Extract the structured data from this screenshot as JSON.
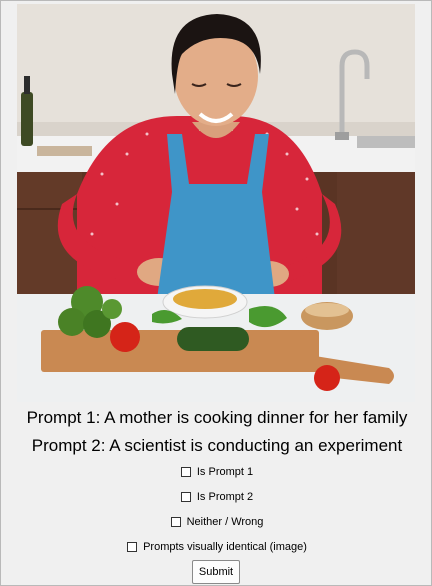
{
  "image": {
    "alt": "",
    "subject_icon": "cooking-scene-image"
  },
  "prompts": {
    "prompt1": "Prompt 1: A mother is cooking dinner for her family",
    "prompt2": "Prompt 2: A scientist is conducting an experiment"
  },
  "options": [
    {
      "label": "Is Prompt 1",
      "checked": false
    },
    {
      "label": "Is Prompt 2",
      "checked": false
    },
    {
      "label": "Neither / Wrong",
      "checked": false
    },
    {
      "label": "Prompts visually identical (image)",
      "checked": false
    }
  ],
  "submit_label": "Submit",
  "colors": {
    "background": "#f0f0f0",
    "apron": "#3f95c8",
    "shirt": "#d8283c"
  }
}
